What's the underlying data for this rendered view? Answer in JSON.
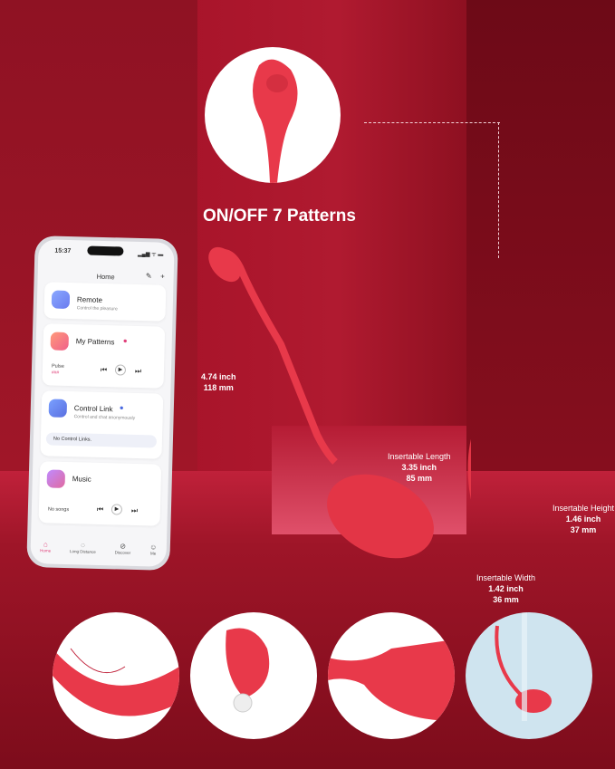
{
  "headline": "ON/OFF 7 Patterns",
  "dimensions": {
    "length": {
      "inch": "4.74 inch",
      "mm": "118 mm"
    },
    "insertable_length": {
      "label": "Insertable Length",
      "inch": "3.35 inch",
      "mm": "85 mm"
    },
    "insertable_height": {
      "label": "Insertable Height",
      "inch": "1.46 inch",
      "mm": "37 mm"
    },
    "insertable_width": {
      "label": "Insertable Width",
      "inch": "1.42 inch",
      "mm": "36 mm"
    }
  },
  "phone": {
    "time": "15:37",
    "status": "▂▄▆ ᯤ ▬",
    "title": "Home",
    "cards": [
      {
        "title": "Remote",
        "subtitle": "Control the pleasure"
      },
      {
        "title": "My Patterns",
        "track": "Pulse",
        "track_sub": "###"
      },
      {
        "title": "Control Link",
        "subtitle": "Control and chat anonymously",
        "empty": "No Control Links."
      },
      {
        "title": "Music",
        "empty": "No songs"
      }
    ],
    "nav": [
      "Home",
      "Long Distance",
      "Discover",
      "Me"
    ]
  },
  "colors": {
    "product": "#e8394a",
    "accent": "#e0407a",
    "bg": "#8e0f1f"
  }
}
